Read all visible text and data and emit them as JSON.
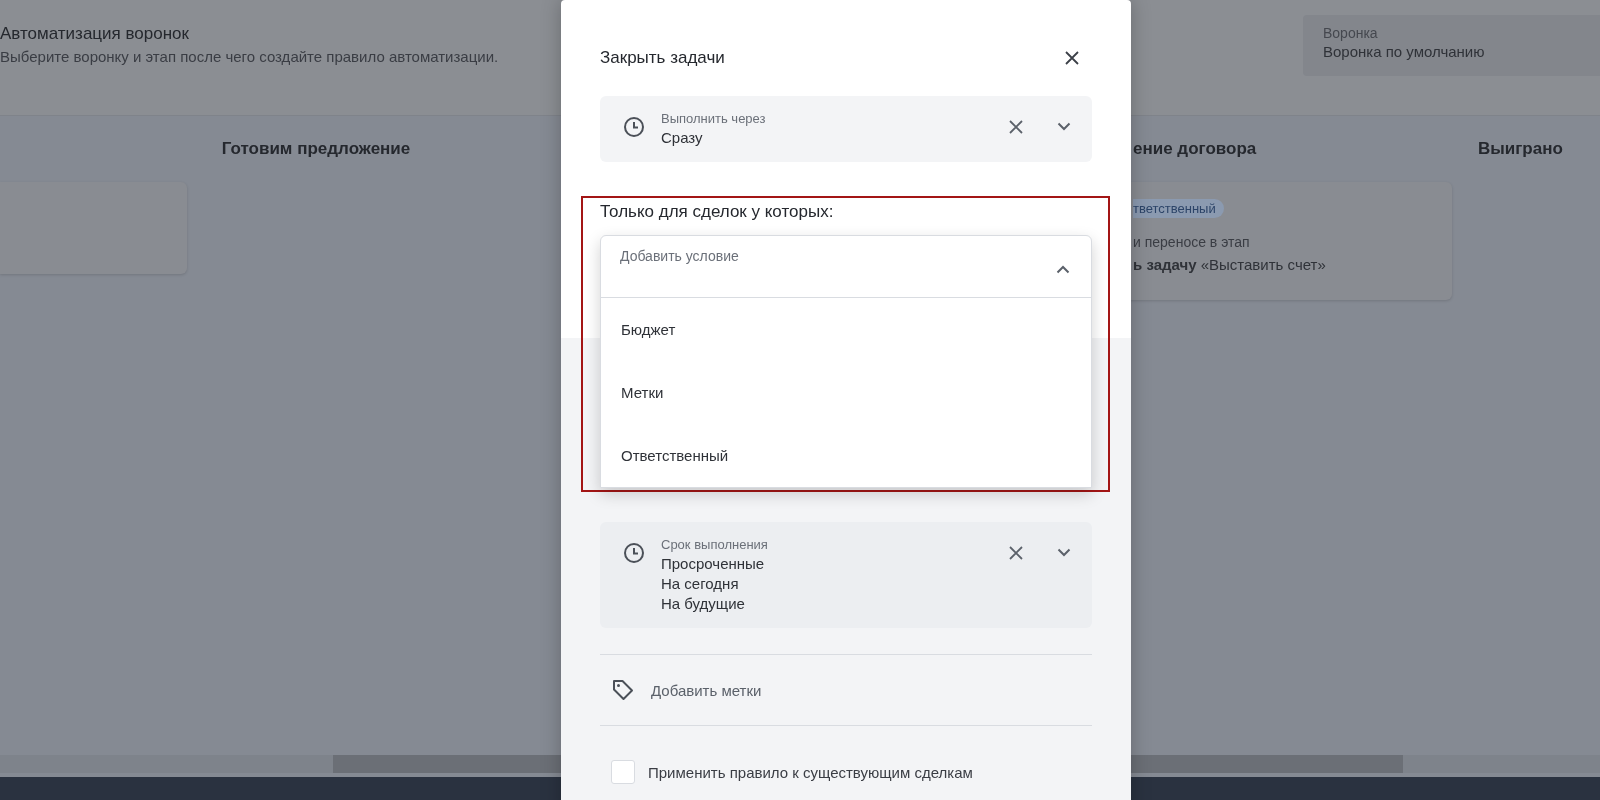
{
  "page": {
    "title": "Автоматизация воронок",
    "subtitle": "Выберите воронку и этап после чего создайте правило автоматизации.",
    "funnel_select": {
      "label": "Воронка",
      "value": "Воронка по умолчанию"
    }
  },
  "board": {
    "columns": [
      {
        "cards": [
          {
            "kind": "blank"
          }
        ]
      },
      {
        "title": "Готовим предложение"
      },
      {
        "title": "ение договора",
        "cards": [
          {
            "kind": "rule",
            "badge": "тветственный",
            "trigger": "и переносе в этап",
            "action": "**ь задачу** «Выставить счет»"
          }
        ]
      },
      {
        "title": "Выиграно"
      }
    ]
  },
  "modal": {
    "title": "Закрыть задачи",
    "delay_field": {
      "label": "Выполнить через",
      "values": [
        "Сразу"
      ]
    },
    "conditions": {
      "highlighted": true,
      "heading": "Только для сделок у которых:",
      "dropdown": {
        "placeholder": "Добавить условие",
        "expanded": true,
        "options": [
          "Бюджет",
          "Метки",
          "Ответственный"
        ]
      }
    },
    "due_field": {
      "label": "Срок выполнения",
      "values": [
        "Просроченные",
        "На сегодня",
        "На будущие"
      ]
    },
    "add_tags": "Добавить метки",
    "apply_existing": {
      "label": "Применить правило к существующим сделкам",
      "checked": false
    }
  }
}
